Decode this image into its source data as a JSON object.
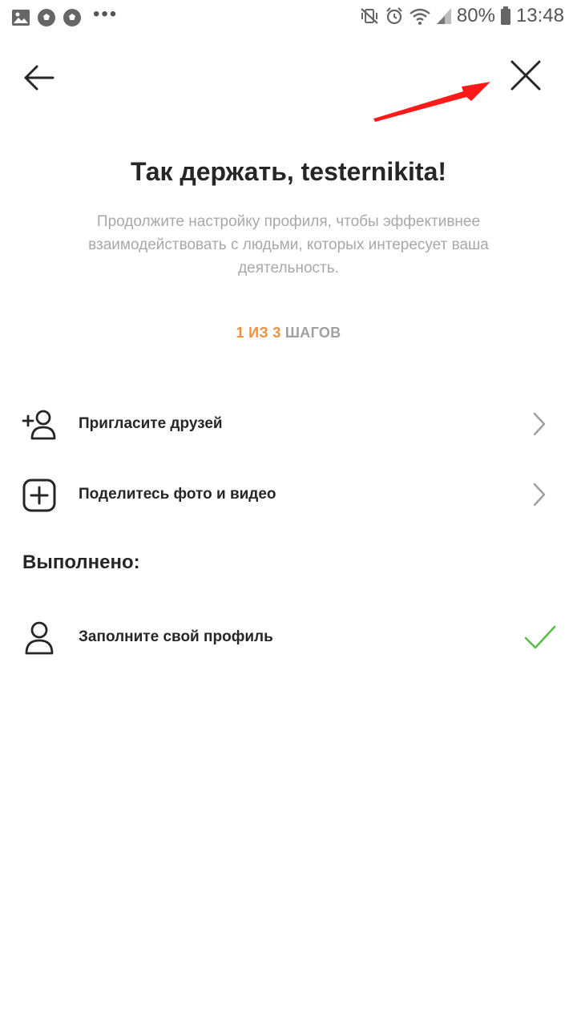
{
  "status_bar": {
    "battery": "80%",
    "time": "13:48",
    "left_icons": [
      "image-icon",
      "soccer-ball-icon",
      "soccer-ball-icon",
      "more-dots-icon"
    ],
    "right_icons": [
      "mute-vibrate-icon",
      "alarm-icon",
      "wifi-icon",
      "signal-icon",
      "battery-icon"
    ]
  },
  "header": {
    "back_icon": "arrow-left-icon",
    "close_icon": "close-icon"
  },
  "intro": {
    "title": "Так держать, testernikita!",
    "subtitle": "Продолжите настройку профиля, чтобы эффективнее взаимодействовать с людьми, которых интересует ваша деятельность."
  },
  "progress": {
    "done_text": "1 ИЗ 3",
    "rest_text": "ШАГОВ"
  },
  "todo": [
    {
      "label": "Пригласите друзей",
      "icon": "add-person-icon"
    },
    {
      "label": "Поделитесь фото и видео",
      "icon": "add-square-icon"
    }
  ],
  "completed": {
    "title": "Выполнено:",
    "items": [
      {
        "label": "Заполните свой профиль",
        "icon": "person-icon",
        "status": "checkmark-icon"
      }
    ]
  },
  "colors": {
    "accent_orange": "#f0913a",
    "check_green": "#5cbd4c",
    "annotation_red": "#ff1a1a"
  }
}
